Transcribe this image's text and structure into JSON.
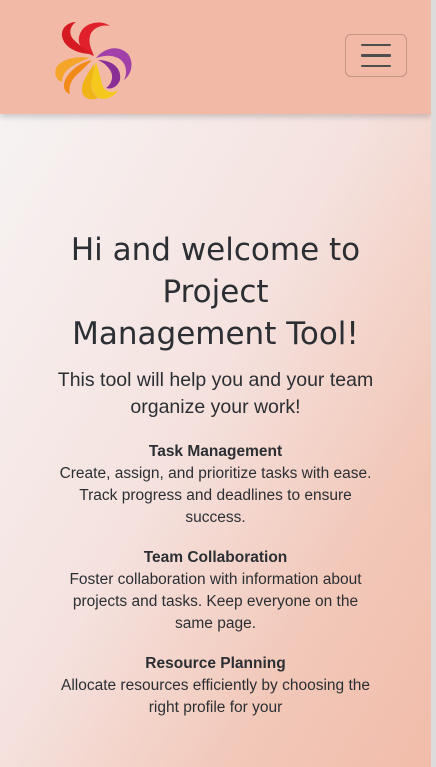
{
  "navbar": {
    "logo_icon": "swirl-logo-icon",
    "toggle_icon": "hamburger-menu-icon",
    "toggle_aria": "Toggle navigation"
  },
  "hero": {
    "title": "Hi and welcome to Project Management Tool!",
    "subtitle": "This tool will help you and your team organize your work!",
    "features": [
      {
        "title": "Task Management",
        "text": "Create, assign, and prioritize tasks with ease. Track progress and deadlines to ensure success."
      },
      {
        "title": "Team Collaboration",
        "text": "Foster collaboration with information about projects and tasks. Keep everyone on the same page."
      },
      {
        "title": "Resource Planning",
        "text": "Allocate resources efficiently by choosing the right profile for your"
      }
    ]
  },
  "colors": {
    "navbar_bg": "#f2baa6",
    "text": "#2b2f33",
    "logo_red": "#e0202a",
    "logo_purple": "#a040a8",
    "logo_orange": "#f28a1a",
    "logo_yellow": "#f5c81e"
  }
}
